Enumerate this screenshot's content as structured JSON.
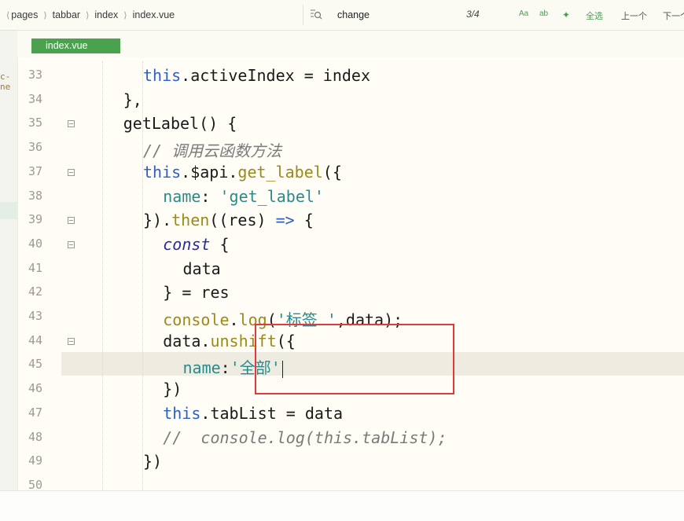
{
  "breadcrumb": {
    "items": [
      "pages",
      "tabbar",
      "index",
      "index.vue"
    ]
  },
  "find": {
    "value": "change",
    "count": "3/4",
    "opt_case": "Aa",
    "opt_word": "ab",
    "select_all": "全选",
    "prev": "上一个",
    "next": "下一个"
  },
  "sidebar_fragment": "c-ne",
  "tab": {
    "label": "index.vue"
  },
  "lines": [
    {
      "num": "33",
      "fold": false,
      "indent": 4,
      "parts": [
        [
          "this",
          "kw"
        ],
        [
          ".activeIndex = index",
          ""
        ]
      ]
    },
    {
      "num": "34",
      "fold": false,
      "indent": 3,
      "parts": [
        [
          "},",
          ""
        ]
      ]
    },
    {
      "num": "35",
      "fold": true,
      "indent": 3,
      "parts": [
        [
          "getLabel() {",
          ""
        ]
      ]
    },
    {
      "num": "36",
      "fold": false,
      "indent": 4,
      "parts": [
        [
          "// 调用云函数方法",
          "cm"
        ]
      ]
    },
    {
      "num": "37",
      "fold": true,
      "indent": 4,
      "parts": [
        [
          "this",
          "kw"
        ],
        [
          ".$api.",
          ""
        ],
        [
          "get_label",
          "fn"
        ],
        [
          "({",
          ""
        ]
      ]
    },
    {
      "num": "38",
      "fold": false,
      "indent": 5,
      "parts": [
        [
          "name",
          "prop"
        ],
        [
          ": ",
          ""
        ],
        [
          "'get_label'",
          "str"
        ]
      ]
    },
    {
      "num": "39",
      "fold": true,
      "indent": 4,
      "parts": [
        [
          "}).",
          ""
        ],
        [
          "then",
          "fn"
        ],
        [
          "((res) ",
          ""
        ],
        [
          "=>",
          "kw"
        ],
        [
          " {",
          ""
        ]
      ]
    },
    {
      "num": "40",
      "fold": true,
      "indent": 5,
      "parts": [
        [
          "const",
          "kws"
        ],
        [
          " {",
          ""
        ]
      ]
    },
    {
      "num": "41",
      "fold": false,
      "indent": 6,
      "parts": [
        [
          "data",
          ""
        ]
      ]
    },
    {
      "num": "42",
      "fold": false,
      "indent": 5,
      "parts": [
        [
          "} = res",
          ""
        ]
      ]
    },
    {
      "num": "43",
      "fold": false,
      "indent": 5,
      "parts": [
        [
          "console",
          "fn"
        ],
        [
          ".",
          ""
        ],
        [
          "log",
          "fn"
        ],
        [
          "(",
          ""
        ],
        [
          "'标签 '",
          "str"
        ],
        [
          ",data);",
          ""
        ]
      ]
    },
    {
      "num": "44",
      "fold": true,
      "indent": 5,
      "parts": [
        [
          "data.",
          ""
        ],
        [
          "unshift",
          "fn"
        ],
        [
          "({",
          ""
        ]
      ]
    },
    {
      "num": "45",
      "fold": false,
      "indent": 6,
      "parts": [
        [
          "name",
          "prop"
        ],
        [
          ":",
          ""
        ],
        [
          "'全部'",
          "str"
        ]
      ],
      "caret": true
    },
    {
      "num": "46",
      "fold": false,
      "indent": 5,
      "parts": [
        [
          "})",
          ""
        ]
      ]
    },
    {
      "num": "47",
      "fold": false,
      "indent": 5,
      "parts": [
        [
          "this",
          "kw"
        ],
        [
          ".tabList = data",
          ""
        ]
      ]
    },
    {
      "num": "48",
      "fold": false,
      "indent": 5,
      "parts": [
        [
          "//  console.log(this.tabList);",
          "cm"
        ]
      ]
    },
    {
      "num": "49",
      "fold": false,
      "indent": 4,
      "parts": [
        [
          "})",
          ""
        ]
      ]
    },
    {
      "num": "50",
      "fold": false,
      "indent": 0,
      "parts": []
    }
  ]
}
